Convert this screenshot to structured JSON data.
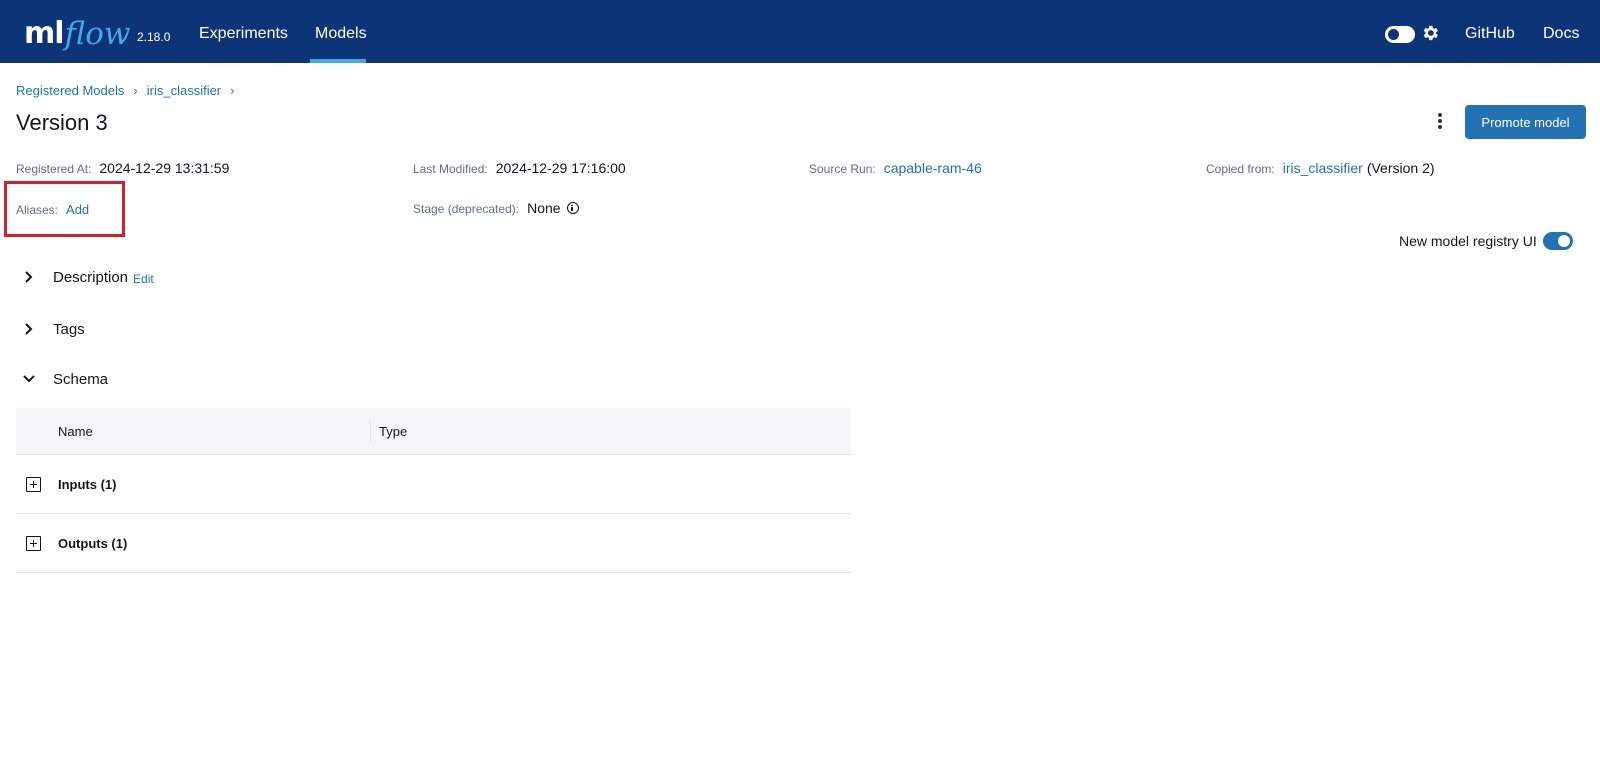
{
  "header": {
    "logo_ml": "ml",
    "logo_flow": "flow",
    "version": "2.18.0",
    "nav": [
      {
        "label": "Experiments",
        "active": false
      },
      {
        "label": "Models",
        "active": true
      }
    ],
    "github_label": "GitHub",
    "docs_label": "Docs",
    "bg_color": "#0e3478",
    "accent_color": "#45a8e8"
  },
  "breadcrumb": [
    "Registered Models",
    "iris_classifier"
  ],
  "breadcrumb_separator": "›",
  "page_title": "Version 3",
  "promote_label": "Promote model",
  "meta": {
    "registered_at": {
      "label": "Registered At:",
      "value": "2024-12-29 13:31:59"
    },
    "last_modified": {
      "label": "Last Modified:",
      "value": "2024-12-29 17:16:00"
    },
    "source_run": {
      "label": "Source Run:",
      "value": "capable-ram-46"
    },
    "copied_from": {
      "label": "Copied from:",
      "value": "iris_classifier",
      "suffix": "(Version 2)"
    },
    "aliases": {
      "label": "Aliases:",
      "value": "Add"
    },
    "stage": {
      "label": "Stage (deprecated):",
      "value": "None"
    }
  },
  "registry_toggle_label": "New model registry UI",
  "registry_toggle_on": true,
  "sections": {
    "description": {
      "title": "Description",
      "edit": "Edit",
      "expanded": false
    },
    "tags": {
      "title": "Tags",
      "expanded": false
    },
    "schema": {
      "title": "Schema",
      "expanded": true
    }
  },
  "schema": {
    "columns": [
      "Name",
      "Type"
    ],
    "rows": [
      "Inputs (1)",
      "Outputs (1)"
    ]
  },
  "highlight_color": "#d0232b"
}
